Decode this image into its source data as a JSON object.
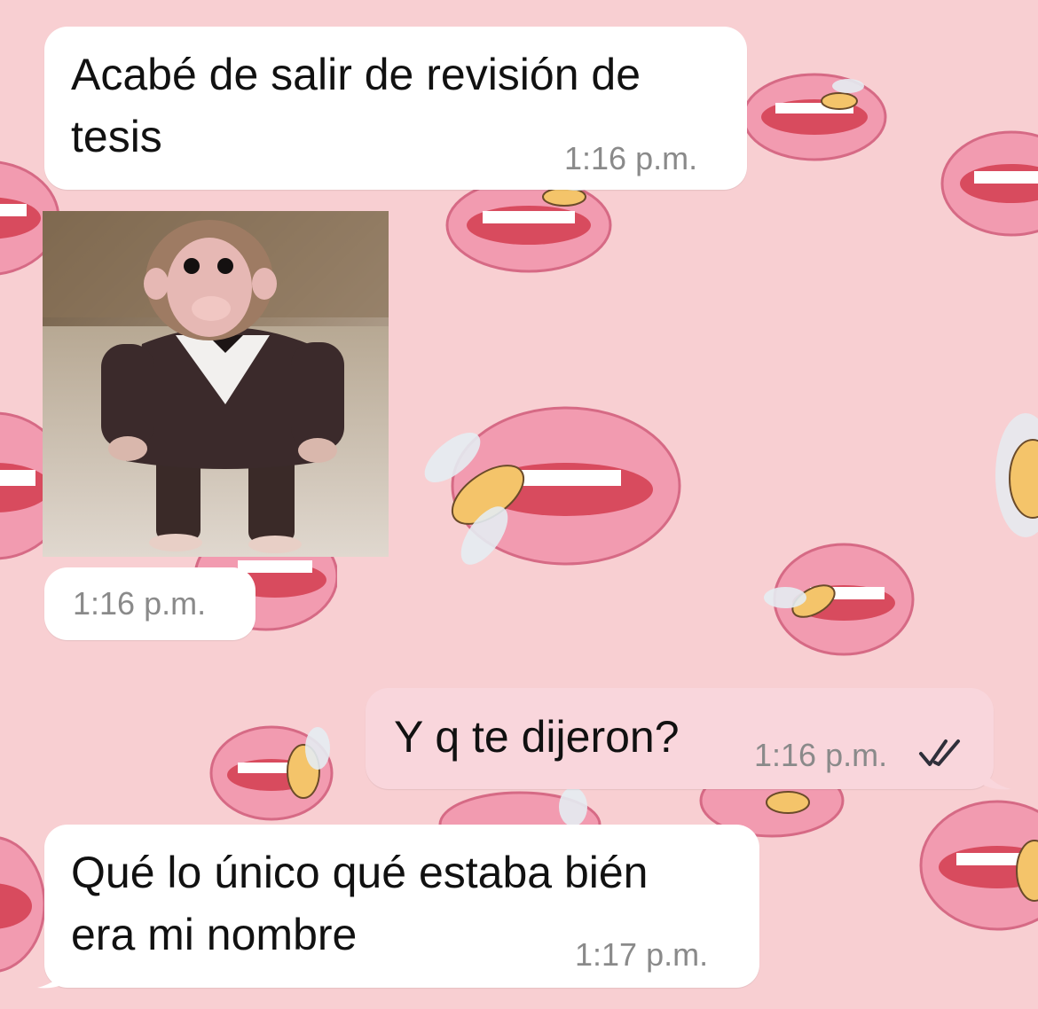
{
  "chat": {
    "messages": [
      {
        "direction": "in",
        "text": "Acabé de salir de revisión de\ntesis",
        "time": "1:16 p.m."
      },
      {
        "direction": "in",
        "type": "sticker",
        "time": "1:16 p.m."
      },
      {
        "direction": "out",
        "text": "Y q te dijeron?",
        "time": "1:16 p.m.",
        "status_icon": "double-check-icon"
      },
      {
        "direction": "in",
        "text": "Qué lo único qué estaba bién\nera mi nombre",
        "time": "1:17 p.m."
      }
    ]
  },
  "colors": {
    "wallpaper": "#f8cfd2",
    "incoming_bubble": "#ffffff",
    "outgoing_bubble": "#f9d6dc",
    "text": "#111111",
    "timestamp": "#8a8a8a",
    "read_tick": "#2f2f3a"
  },
  "icons": {
    "sticker": "monkey-in-suit-sticker",
    "wallpaper": "lips-and-bee-pattern"
  }
}
